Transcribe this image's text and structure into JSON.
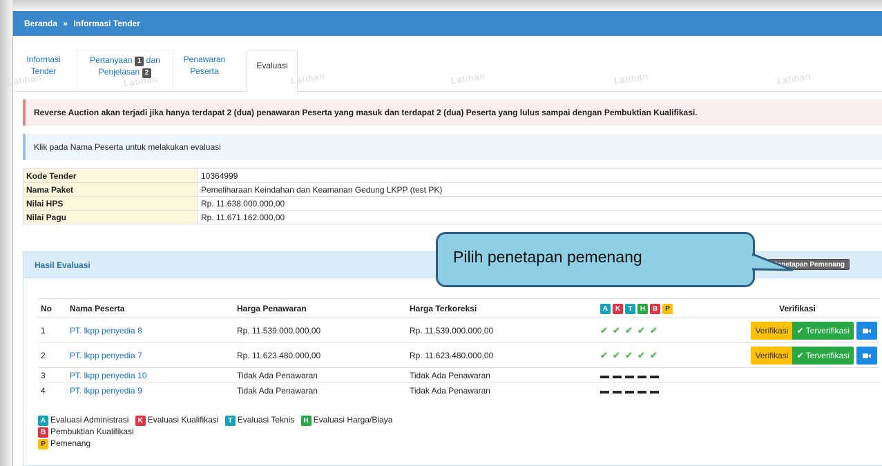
{
  "breadcrumb": {
    "home": "Beranda",
    "separator": "»",
    "current": "Informasi Tender"
  },
  "tabs": {
    "informasi_line1": "Informasi",
    "informasi_line2": "Tender",
    "pertanyaan_line1a": "Pertanyaan",
    "pertanyaan_badge1": "1",
    "pertanyaan_line1b": "dan",
    "pertanyaan_line2": "Penjelasan",
    "pertanyaan_badge2": "2",
    "penawaran_line1": "Penawaran",
    "penawaran_line2": "Peserta",
    "evaluasi": "Evaluasi"
  },
  "watermark": "Latihan",
  "alerts": {
    "reverse_auction": "Reverse Auction akan terjadi jika hanya terdapat 2 (dua) penawaran Peserta yang masuk dan terdapat 2 (dua) Peserta yang lulus sampai dengan Pembuktian Kualifikasi.",
    "hint": "Klik pada Nama Peserta untuk melakukan evaluasi"
  },
  "info": {
    "kode_label": "Kode Tender",
    "kode_value": "10364999",
    "paket_label": "Nama Paket",
    "paket_value": "Pemeliharaan Keindahan dan Keamanan Gedung LKPP (test PK)",
    "hps_label": "Nilai HPS",
    "hps_value": "Rp. 11.638.000.000,00",
    "pagu_label": "Nilai Pagu",
    "pagu_value": "Rp. 11.671.162.000,00"
  },
  "panel": {
    "title": "Hasil Evaluasi",
    "penetapan_button": "Penetapan Pemenang"
  },
  "callout": "Pilih penetapan pemenang",
  "table": {
    "headers": {
      "no": "No",
      "nama": "Nama Peserta",
      "harga": "Harga Penawaran",
      "terkoreksi": "Harga Terkoreksi",
      "verifikasi": "Verifikasi"
    },
    "badges": {
      "a": "A",
      "k": "K",
      "t": "T",
      "h": "H",
      "b": "B",
      "p": "P"
    },
    "rows": [
      {
        "no": "1",
        "nama": "PT. lkpp penyedia 8",
        "harga": "Rp. 11.539.000.000,00",
        "terkoreksi": "Rp. 11.539.000.000,00"
      },
      {
        "no": "2",
        "nama": "PT. lkpp penyedia 7",
        "harga": "Rp. 11.623.480.000,00",
        "terkoreksi": "Rp. 11.623.480.000,00"
      },
      {
        "no": "3",
        "nama": "PT. lkpp penyedia 10",
        "harga": "Tidak Ada Penawaran",
        "terkoreksi": "Tidak Ada Penawaran"
      },
      {
        "no": "4",
        "nama": "PT. lkpp penyedia 9",
        "harga": "Tidak Ada Penawaran",
        "terkoreksi": "Tidak Ada Penawaran"
      }
    ],
    "check_glyph": "✔",
    "dash_glyph": "▬",
    "verifikasi_label": "Verifikasi",
    "terverifikasi_label": "✔ Terverifikasi",
    "video_icon": "video-camera-icon"
  },
  "legend": {
    "a": "Evaluasi Administrasi",
    "k": "Evaluasi Kualifikasi",
    "t": "Evaluasi Teknis",
    "h": "Evaluasi Harga/Biaya",
    "b": "Pembuktian Kualifikasi",
    "p": "Pemenang"
  },
  "colors": {
    "header_blue": "#3a87c9",
    "link_blue": "#1a73c8",
    "callout_fill": "#8fcfe6",
    "check_green": "#5cb85c"
  }
}
